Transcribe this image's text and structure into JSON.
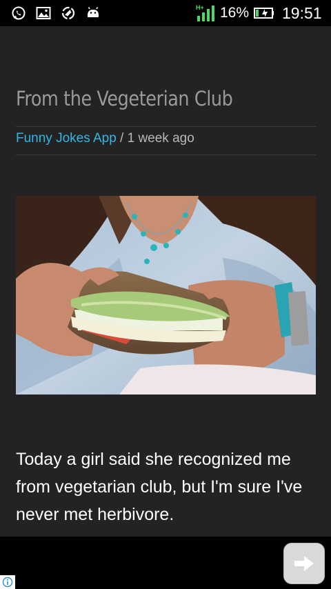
{
  "status_bar": {
    "battery_percent": "16%",
    "time": "19:51",
    "network_label": "H+",
    "left_icons": [
      "whatsapp-icon",
      "gallery-icon",
      "sync-icon",
      "android-icon"
    ],
    "right_icons": [
      "signal-icon",
      "battery-icon"
    ]
  },
  "article": {
    "title": "From the Vegeterian Club",
    "source": "Funny Jokes App",
    "separator": " / ",
    "time_ago": "1 week ago",
    "image": "woman-holding-vegetable-sandwich",
    "body": "Today a girl said she recognized me from vegetarian club, but I'm sure I've never met herbivore."
  },
  "footer": {
    "next_icon": "arrow-right-icon",
    "ad_info_icon": "info-icon"
  },
  "colors": {
    "background": "#232323",
    "title": "#9a9a9a",
    "link": "#33b5e5",
    "body_text": "#ffffff"
  }
}
